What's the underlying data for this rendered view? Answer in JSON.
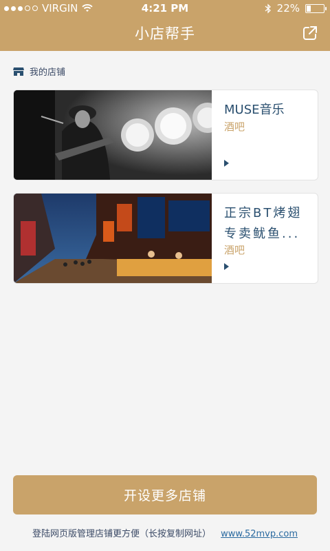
{
  "status_bar": {
    "carrier": "VIRGIN",
    "time": "4:21 PM",
    "battery_percent": "22%",
    "battery_level": 0.22
  },
  "nav": {
    "title": "小店帮手",
    "share_icon": "external-link-icon"
  },
  "section": {
    "label": "我的店铺",
    "icon": "store-icon"
  },
  "shops": [
    {
      "name": "MUSE音乐",
      "type": "酒吧"
    },
    {
      "name": "正宗BT烤翅专卖鱿鱼...",
      "type": "酒吧"
    }
  ],
  "actions": {
    "open_more": "开设更多店铺"
  },
  "footer": {
    "text": "登陆网页版管理店铺更方便（长按复制网址）",
    "url": "www.52mvp.com"
  },
  "colors": {
    "brand": "#c9a36a",
    "text_blue": "#2a4f6f",
    "background": "#f4f4f4"
  }
}
